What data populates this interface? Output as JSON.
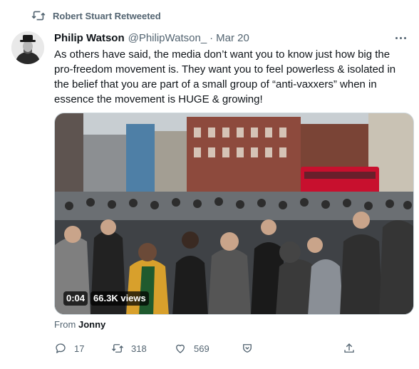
{
  "retweet": {
    "label": "Robert Stuart Retweeted"
  },
  "tweet": {
    "author_name": "Philip Watson",
    "handle": "@PhilipWatson_",
    "separator": "·",
    "date": "Mar 20",
    "text": "As others have said, the media don’t want you to know just how big the pro-freedom movement is. They want you to feel powerless & isolated in the belief that you are part of a small group of “anti-vaxxers” when in essence the movement is HUGE & growing!",
    "video": {
      "duration": "0:04",
      "views": "66.3K views"
    },
    "source": {
      "prefix": "From",
      "name": "Jonny"
    }
  },
  "actions": {
    "reply_count": "17",
    "retweet_count": "318",
    "like_count": "569"
  },
  "colors": {
    "muted": "#536471",
    "text": "#0f1419",
    "bus_red": "#c8102e"
  }
}
